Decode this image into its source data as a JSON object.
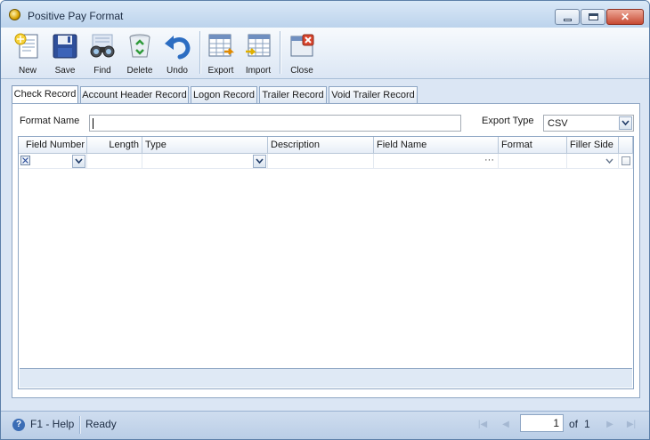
{
  "window": {
    "title": "Positive Pay Format"
  },
  "toolbar": {
    "buttons": [
      {
        "id": "new",
        "label": "New",
        "icon": "new-document-icon"
      },
      {
        "id": "save",
        "label": "Save",
        "icon": "floppy-disk-icon"
      },
      {
        "id": "find",
        "label": "Find",
        "icon": "binoculars-icon"
      },
      {
        "id": "delete",
        "label": "Delete",
        "icon": "recycle-bin-icon"
      },
      {
        "id": "undo",
        "label": "Undo",
        "icon": "undo-arrow-icon"
      },
      {
        "id": "export",
        "label": "Export",
        "icon": "export-table-icon"
      },
      {
        "id": "import",
        "label": "Import",
        "icon": "import-table-icon"
      },
      {
        "id": "close",
        "label": "Close",
        "icon": "close-window-icon"
      }
    ]
  },
  "tabs": [
    {
      "label": "Check Record",
      "active": true
    },
    {
      "label": "Account Header Record",
      "active": false
    },
    {
      "label": "Logon Record",
      "active": false
    },
    {
      "label": "Trailer Record",
      "active": false
    },
    {
      "label": "Void Trailer Record",
      "active": false
    }
  ],
  "form": {
    "format_name_label": "Format Name",
    "format_name_value": "",
    "export_type_label": "Export Type",
    "export_type_value": "CSV"
  },
  "grid": {
    "columns": [
      "Field Number",
      "Length",
      "Type",
      "Description",
      "Field Name",
      "Format",
      "Filler Side"
    ],
    "new_row": {
      "field_name_ellipsis": "···"
    }
  },
  "status": {
    "help_label": "F1 - Help",
    "state": "Ready",
    "page_current": "1",
    "page_of": "of",
    "page_total": "1"
  },
  "colors": {
    "accent": "#3b6db5",
    "window_bg": "#dbe6f4",
    "border": "#8ea6c4"
  }
}
